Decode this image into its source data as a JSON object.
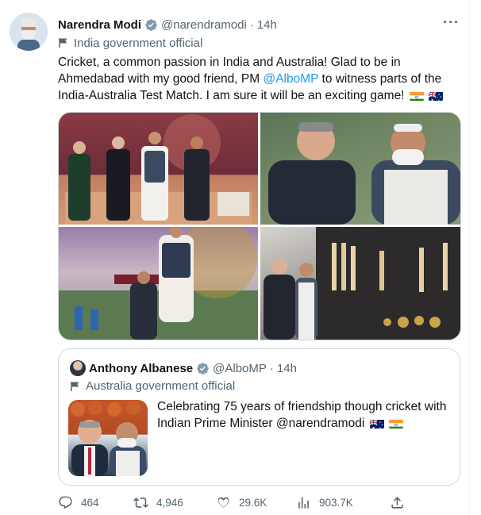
{
  "tweet": {
    "author_name": "Narendra Modi",
    "handle": "@narendramodi",
    "separator": "·",
    "time": "14h",
    "more": "···",
    "label": "India government official",
    "text_1": "Cricket, a common passion in India and Australia! Glad to be in Ahmedabad with my good friend, PM ",
    "mention": "@AlboMP",
    "text_2": " to witness parts of the India-Australia Test Match. I am sure it will be an exciting game! "
  },
  "quote": {
    "author_name": "Anthony Albanese",
    "handle": "@AlboMP",
    "separator": "·",
    "time": "14h",
    "label": "Australia government official",
    "text": "Celebrating 75 years of friendship though cricket with Indian Prime Minister @narendramodi "
  },
  "actions": {
    "replies": "464",
    "retweets": "4,946",
    "likes": "29.6K",
    "views": "903.7K"
  },
  "colors": {
    "accent": "#1d9bf0",
    "secondary_text": "#536471",
    "border": "#cfd9de",
    "verified_gray": "#829aab"
  },
  "icons": [
    "more-icon",
    "verified-icon",
    "government-flag-icon",
    "reply-icon",
    "retweet-icon",
    "like-icon",
    "views-icon",
    "share-icon",
    "india-flag-emoji",
    "australia-flag-emoji"
  ]
}
